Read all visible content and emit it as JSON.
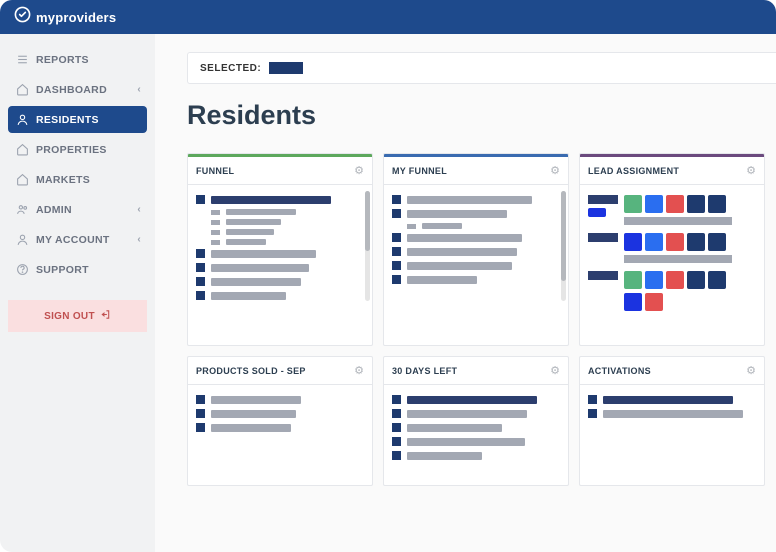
{
  "brand": {
    "my": "my",
    "providers": "providers"
  },
  "nav": {
    "reports": "REPORTS",
    "dashboard": "DASHBOARD",
    "residents": "RESIDENTS",
    "properties": "PROPERTIES",
    "markets": "MARKETS",
    "admin": "ADMIN",
    "myaccount": "MY ACCOUNT",
    "support": "SUPPORT",
    "signout": "SIGN OUT"
  },
  "selected_label": "SELECTED:",
  "page_title": "Residents",
  "cards": {
    "funnel": "FUNNEL",
    "my_funnel": "MY FUNNEL",
    "lead_assignment": "LEAD ASSIGNMENT",
    "products_sold": "PRODUCTS SOLD - SEP",
    "days_left": "30 DAYS LEFT",
    "activations": "ACTIVATIONS"
  }
}
